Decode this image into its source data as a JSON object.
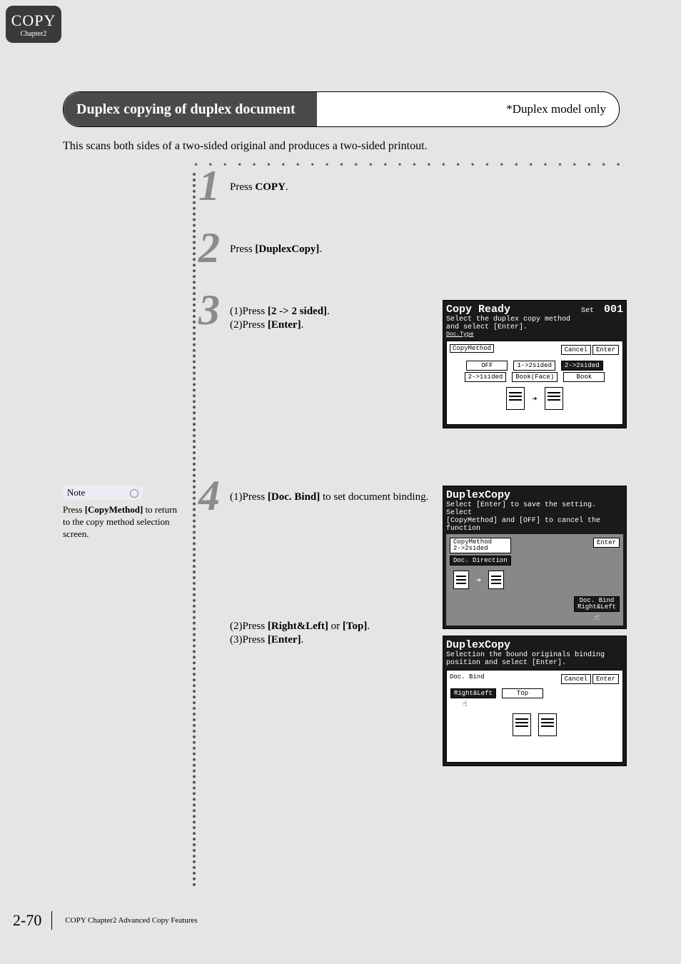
{
  "tab": {
    "title": "COPY",
    "subtitle": "Chapter2"
  },
  "header": {
    "title": "Duplex copying of duplex document",
    "note": "*Duplex model only"
  },
  "intro": "This scans both sides of a two-sided original and produces a two-sided printout.",
  "steps": {
    "s1": {
      "num": "1",
      "a": "Press ",
      "b": "COPY",
      "c": "."
    },
    "s2": {
      "num": "2",
      "a": "Press ",
      "b": "[DuplexCopy]",
      "c": "."
    },
    "s3": {
      "num": "3",
      "l1a": "(1)Press ",
      "l1b": "[2 -> 2 sided]",
      "l1c": ".",
      "l2a": "(2)Press ",
      "l2b": "[Enter]",
      "l2c": "."
    },
    "s4": {
      "num": "4",
      "l1a": "(1)Press ",
      "l1b": "[Doc. Bind]",
      "l1c": " to set document binding.",
      "l2a": "(2)Press ",
      "l2b": "[Right&Left]",
      "l2m": " or ",
      "l2b2": "[Top]",
      "l2c": ".",
      "l3a": "(3)Press ",
      "l3b": "[Enter]",
      "l3c": "."
    }
  },
  "note": {
    "label": "Note",
    "text_a": "Press ",
    "text_b": "[CopyMethod]",
    "text_c": " to return to the copy method selection screen."
  },
  "screen3": {
    "title": "Copy Ready",
    "set": "Set",
    "count": "001",
    "msg1": "Select the duplex copy method",
    "msg2": "and select [Enter].",
    "panel": "CopyMethod",
    "doctype": "Doc.Type",
    "btn_cancel": "Cancel",
    "btn_enter": "Enter",
    "opt1": "OFF",
    "opt2": "1->2sided",
    "opt3": "2->2sided",
    "opt4": "2->1sided",
    "opt5": "Book(Face)",
    "opt6": "Book"
  },
  "screen4a": {
    "title": "DuplexCopy",
    "msg1": "Select [Enter] to save the setting. Select",
    "msg2": "[CopyMethod] and [OFF] to cancel the function",
    "cm": "CopyMethod",
    "cm2": "2->2sided",
    "dd": "Doc. Direction",
    "enter": "Enter",
    "db": "Doc. Bind",
    "rl": "Right&Left"
  },
  "screen4b": {
    "title": "DuplexCopy",
    "msg1": "Selection the bound originals binding",
    "msg2": "position and select [Enter].",
    "db": "Doc. Bind",
    "cancel": "Cancel",
    "enter": "Enter",
    "rl": "Right&Left",
    "top": "Top"
  },
  "footer": {
    "page": "2-70",
    "text": "COPY Chapter2     Advanced Copy Features"
  }
}
